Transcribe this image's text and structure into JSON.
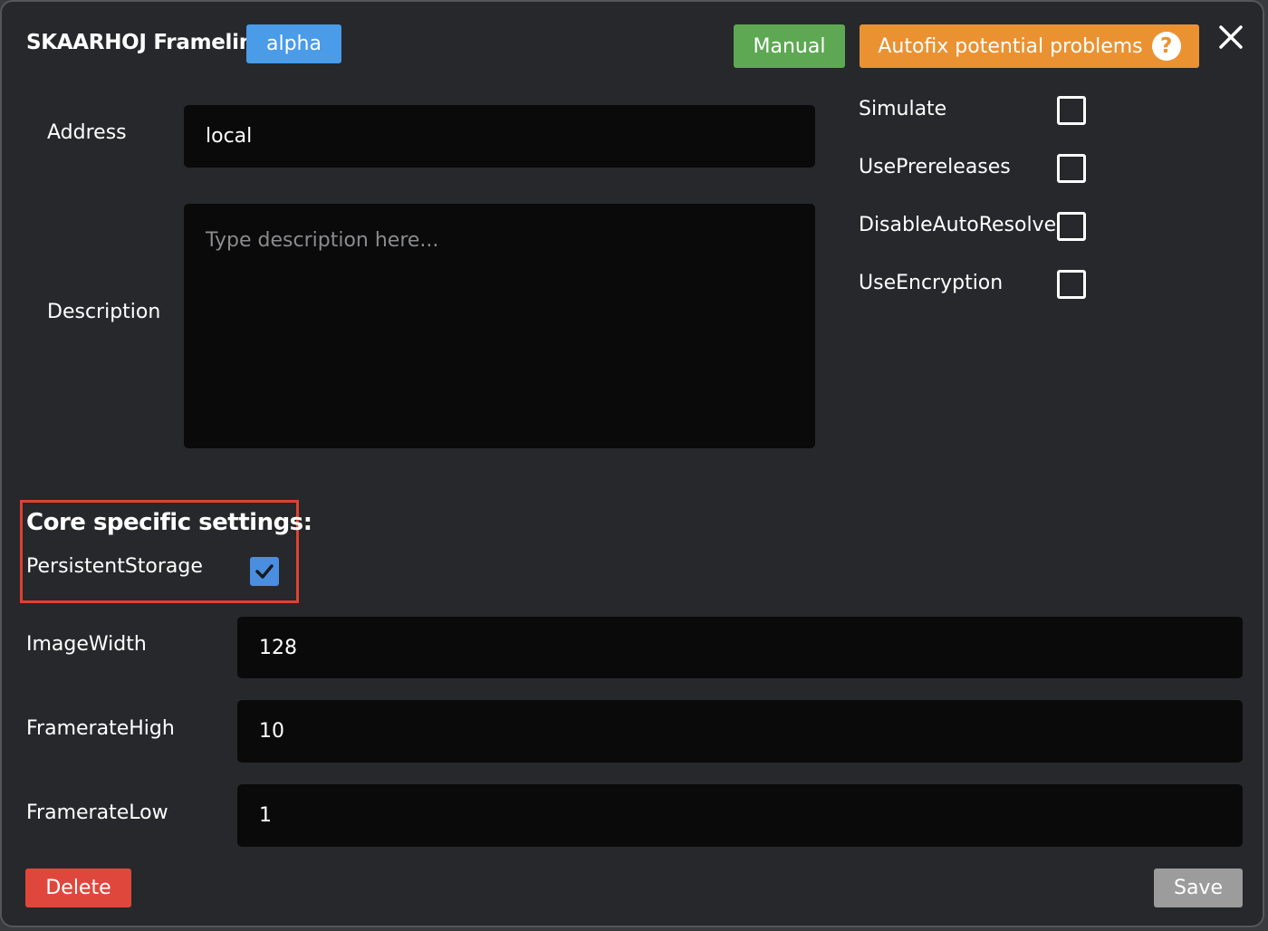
{
  "header": {
    "title": "SKAARHOJ Framelink",
    "badge": "alpha",
    "manual_label": "Manual",
    "autofix_label": "Autofix potential problems",
    "help_glyph": "?"
  },
  "fields": {
    "address_label": "Address",
    "address_value": "local",
    "description_label": "Description",
    "description_placeholder": "Type description here..."
  },
  "options": {
    "simulate_label": "Simulate",
    "simulate_checked": false,
    "use_prereleases_label": "UsePrereleases",
    "use_prereleases_checked": false,
    "disable_auto_resolve_label": "DisableAutoResolve",
    "disable_auto_resolve_checked": false,
    "use_encryption_label": "UseEncryption",
    "use_encryption_checked": false
  },
  "core": {
    "title": "Core specific settings:",
    "persistent_storage_label": "PersistentStorage",
    "persistent_storage_checked": true,
    "image_width_label": "ImageWidth",
    "image_width_value": "128",
    "framerate_high_label": "FramerateHigh",
    "framerate_high_value": "10",
    "framerate_low_label": "FramerateLow",
    "framerate_low_value": "1"
  },
  "footer": {
    "delete_label": "Delete",
    "save_label": "Save"
  },
  "colors": {
    "background": "#27282b",
    "badge": "#4a9be8",
    "manual": "#5ea854",
    "autofix": "#ea9232",
    "highlight_border": "#e0412f",
    "checkbox_checked": "#4a8ee0",
    "delete": "#e0473c",
    "save": "#9c9c9c"
  },
  "icons": {
    "close": "close-icon",
    "help": "question-circle-icon",
    "check": "checkmark-icon"
  }
}
